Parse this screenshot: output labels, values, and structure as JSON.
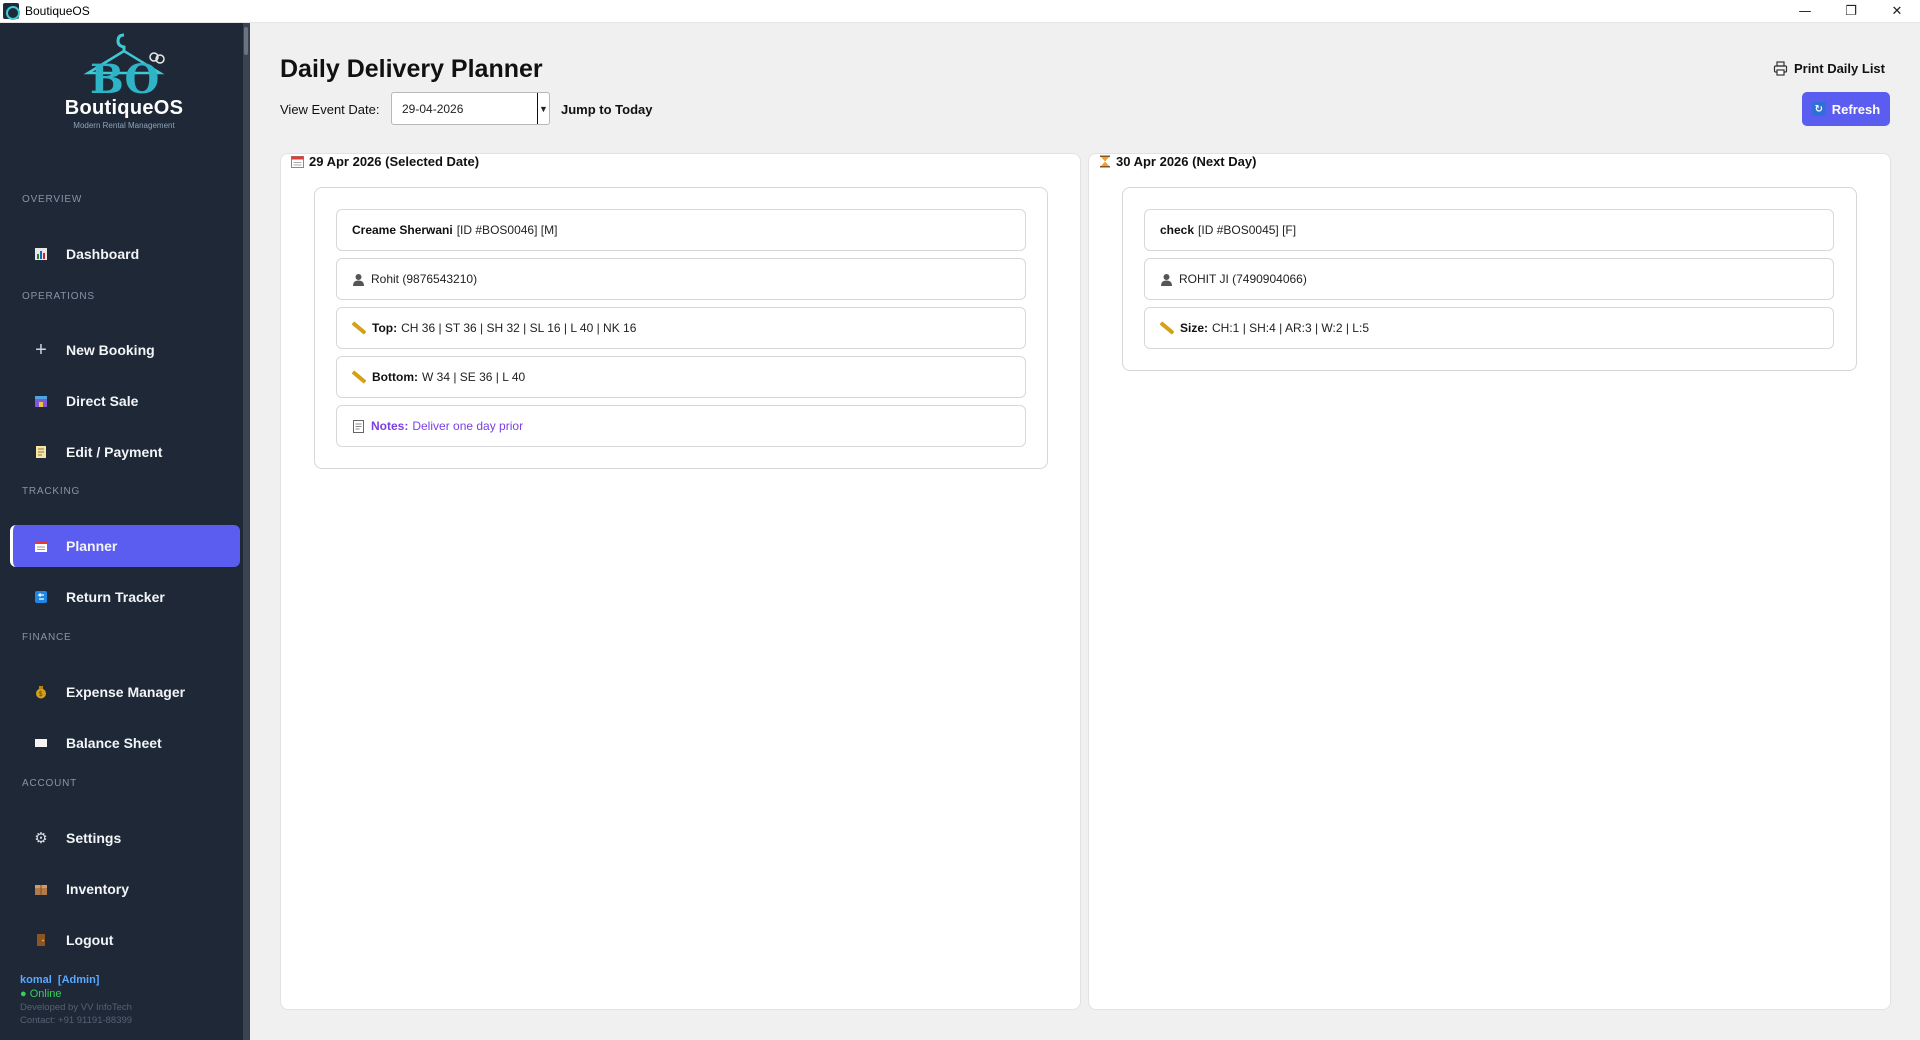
{
  "window": {
    "title": "BoutiqueOS",
    "controls": [
      "—",
      "❐",
      "✕"
    ]
  },
  "brand": {
    "name": "BoutiqueOS",
    "tagline": "Modern Rental Management"
  },
  "sidebar": {
    "sections": {
      "overview": "OVERVIEW",
      "operations": "OPERATIONS",
      "tracking": "TRACKING",
      "finance": "FINANCE",
      "account": "ACCOUNT"
    },
    "items": [
      {
        "label": "Dashboard",
        "icon": "chart-icon"
      },
      {
        "label": "New Booking",
        "icon": "plus-icon"
      },
      {
        "label": "Direct Sale",
        "icon": "shop-icon"
      },
      {
        "label": "Edit / Payment",
        "icon": "memo-icon"
      },
      {
        "label": "Planner",
        "icon": "calendar-icon",
        "active": true
      },
      {
        "label": "Return Tracker",
        "icon": "return-icon"
      },
      {
        "label": "Expense Manager",
        "icon": "money-bag-icon"
      },
      {
        "label": "Balance Sheet",
        "icon": "sheet-icon"
      },
      {
        "label": "Settings",
        "icon": "gear-icon"
      },
      {
        "label": "Inventory",
        "icon": "box-icon"
      },
      {
        "label": "Logout",
        "icon": "door-icon"
      }
    ],
    "user": {
      "name": "komal",
      "role": "[Admin]",
      "status": "● Online",
      "developer": "Developed by VV InfoTech",
      "contact": "Contact: +91 91191-88399"
    }
  },
  "planner": {
    "title": "Daily Delivery Planner",
    "date_label": "View Event Date:",
    "date_value": "29-04-2026",
    "jump_today": "Jump to Today",
    "print": "Print Daily List",
    "refresh": "Refresh",
    "selected": {
      "header": "29 Apr 2026 (Selected Date)",
      "item_name": "Creame Sherwani",
      "item_id": "[ID #BOS0046] [M]",
      "customer": "Rohit (9876543210)",
      "top_label": "Top:",
      "top_value": "CH 36 | ST 36 | SH 32 | SL 16 | L 40 | NK 16",
      "bottom_label": "Bottom:",
      "bottom_value": "W 34 | SE 36 | L 40",
      "notes_label": "Notes:",
      "notes_value": "Deliver one day prior"
    },
    "next": {
      "header": "30 Apr 2026 (Next Day)",
      "item_name": "check",
      "item_id": "[ID #BOS0045] [F]",
      "customer": "ROHIT JI (7490904066)",
      "size_label": "Size:",
      "size_value": "CH:1 | SH:4 | AR:3 | W:2 | L:5"
    }
  },
  "colors": {
    "sidebar_bg": "#1e2836",
    "accent": "#5b5cf0",
    "notes": "#7b3fe4",
    "online": "#34d058"
  }
}
